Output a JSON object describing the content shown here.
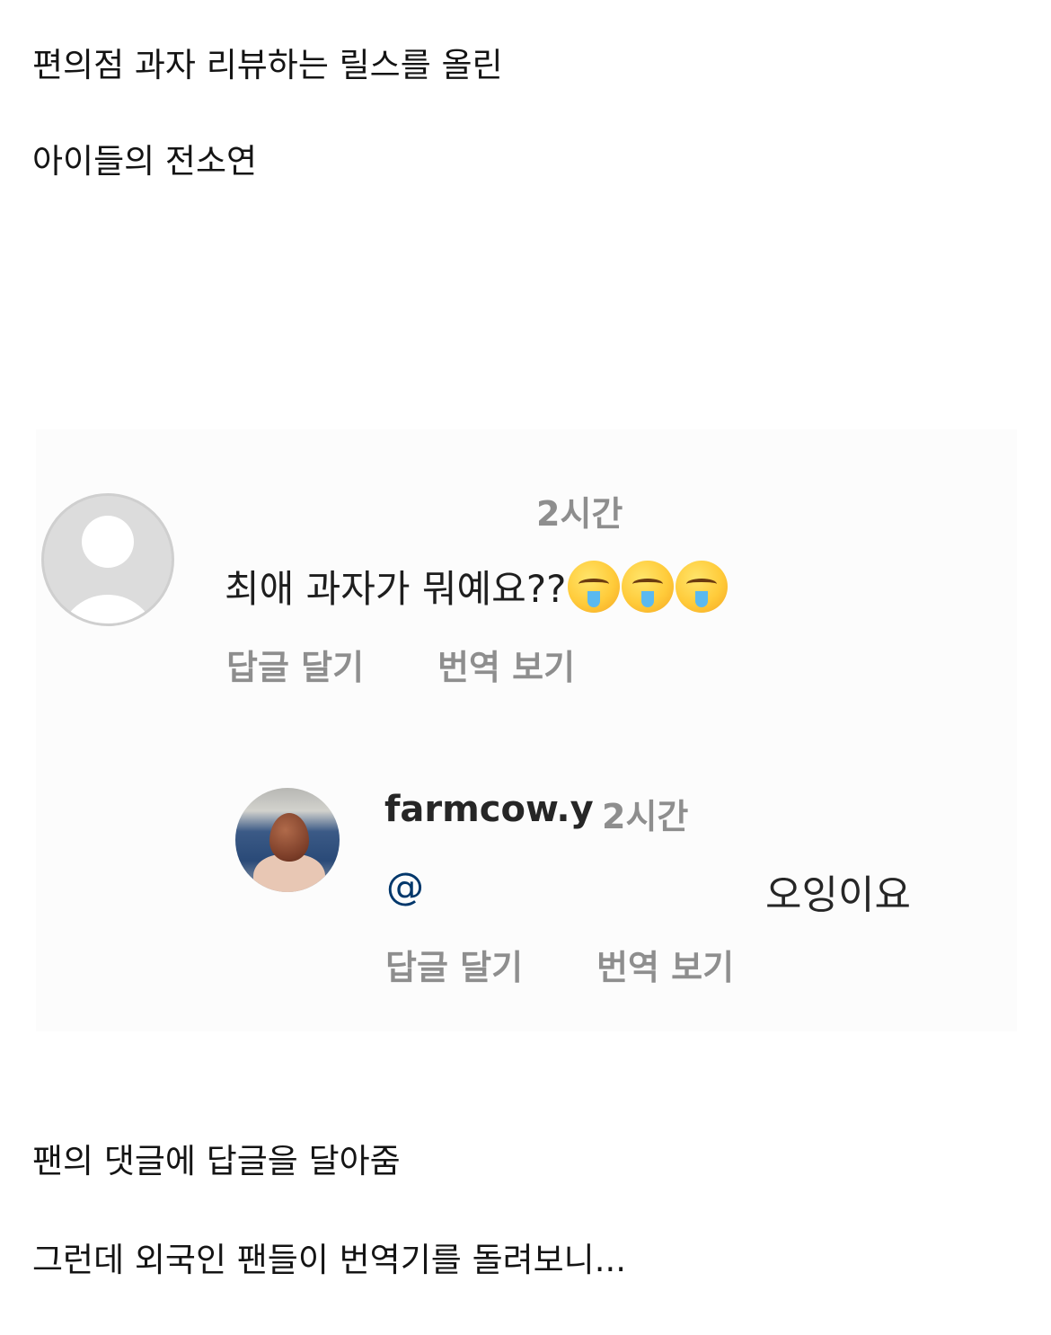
{
  "captions": {
    "line1": "편의점 과자 리뷰하는 릴스를 올린",
    "line2": "아이들의 전소연",
    "line3": "팬의 댓글에 답글을 달아줌",
    "line4": "그런데 외국인 팬들이 번역기를 돌려보니..."
  },
  "comment": {
    "time": "2시간",
    "text": "최애 과자가 뭐예요??",
    "emojis": [
      "drooling-face",
      "drooling-face",
      "drooling-face"
    ],
    "reply_action": "답글 달기",
    "translate_action": "번역 보기"
  },
  "reply": {
    "username": "farmcow.y",
    "time": "2시간",
    "mention": "@",
    "text": "오잉이요",
    "reply_action": "답글 달기",
    "translate_action": "번역 보기"
  },
  "colors": {
    "meta_gray": "#8e8e8e",
    "mention_blue": "#00376b",
    "text_dark": "#262626"
  }
}
